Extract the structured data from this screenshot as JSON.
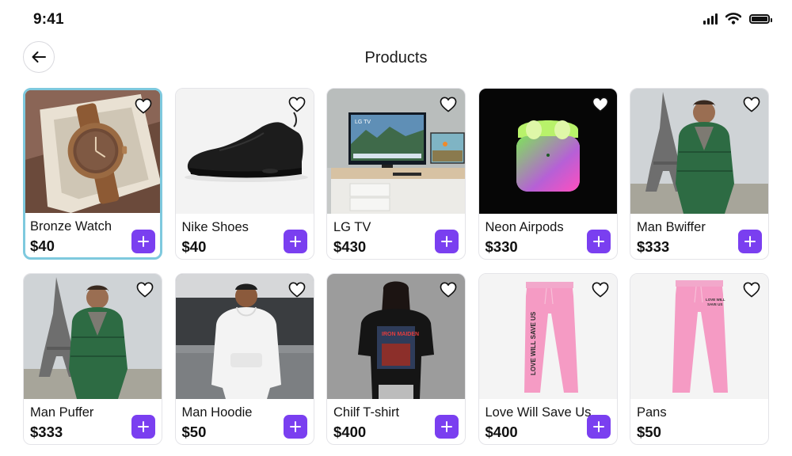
{
  "status_bar": {
    "time": "9:41"
  },
  "header": {
    "title": "Products"
  },
  "colors": {
    "accent": "#7a3ff0",
    "selected_border": "#7ec9de",
    "card_border": "#e4e4e8"
  },
  "products": [
    {
      "name": "Bronze Watch",
      "price": "$40",
      "image": "bronze-watch-image",
      "selected": true
    },
    {
      "name": "Nike Shoes",
      "price": "$40",
      "image": "black-sneaker-image"
    },
    {
      "name": "LG TV",
      "price": "$430",
      "image": "lg-tv-image"
    },
    {
      "name": "Neon Airpods",
      "price": "$330",
      "image": "neon-airpods-image"
    },
    {
      "name": "Man Bwiffer",
      "price": "$333",
      "image": "man-puffer-eiffel-image"
    },
    {
      "name": "Man Puffer",
      "price": "$333",
      "image": "man-puffer-eiffel-image"
    },
    {
      "name": "Man Hoodie",
      "price": "$50",
      "image": "man-hoodie-image"
    },
    {
      "name": "Chilf T-shirt",
      "price": "$400",
      "image": "woman-tshirt-image"
    },
    {
      "name": "Love Will Save Us",
      "price": "$400",
      "image": "pink-pants-text-image"
    },
    {
      "name": "Pans",
      "price": "$50",
      "image": "pink-pants-image"
    }
  ]
}
